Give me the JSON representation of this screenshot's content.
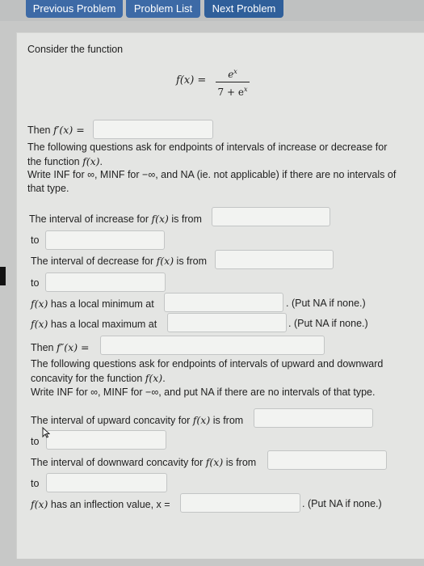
{
  "nav": {
    "previous": "Previous Problem",
    "list": "Problem List",
    "next": "Next Problem"
  },
  "problem": {
    "intro": "Consider the function",
    "formula": {
      "lhs": "f(x) = ",
      "numerator": "e",
      "numerator_exp": "x",
      "denominator_base": "7 + e",
      "denominator_exp": "x"
    },
    "derivative_prompt_prefix": "Then ",
    "derivative_prompt_symbol": "f′(x) =",
    "instructions_1a": "The following questions ask for endpoints of intervals of increase or decrease for the function ",
    "instructions_1b": "f(x)",
    "instructions_1c": ".",
    "instructions_2a": "Write INF for ∞, MINF for −∞, and NA (ie. not applicable) if there are no intervals of that type.",
    "increase_prefix": "The interval of increase for ",
    "increase_fx": "f(x)",
    "increase_suffix": " is from",
    "to_1": "to",
    "decrease_prefix": "The interval of decrease for ",
    "decrease_fx": "f(x)",
    "decrease_suffix": " is from",
    "to_2": "to",
    "min_fx": "f(x)",
    "min_text": " has a local minimum at",
    "min_note": ". (Put NA if none.)",
    "max_fx": "f(x)",
    "max_text": " has a local maximum at",
    "max_note": ". (Put NA if none.)",
    "second_prompt_prefix": "Then ",
    "second_prompt_symbol": "f″(x) =",
    "concavity_instr_a": "The following questions ask for endpoints of intervals of upward and downward concavity for the function ",
    "concavity_instr_b": "f(x)",
    "concavity_instr_c": ".",
    "concavity_instr_2": "Write INF for ∞, MINF for −∞, and put NA if there are no intervals of that type.",
    "up_prefix": "The interval of upward concavity for ",
    "up_fx": "f(x)",
    "up_suffix": " is from",
    "to_3": "to",
    "down_prefix": "The interval of downward concavity for ",
    "down_fx": "f(x)",
    "down_suffix": " is from",
    "to_4": "to",
    "inflection_fx": "f(x)",
    "inflection_text": " has an inflection value, x =",
    "inflection_note": ". (Put NA if none.)"
  },
  "fields": {
    "derivative": "",
    "increase_from": "",
    "increase_to": "",
    "decrease_from": "",
    "decrease_to": "",
    "local_min": "",
    "local_max": "",
    "second_derivative": "",
    "up_from": "",
    "up_to": "",
    "down_from": "",
    "down_to": "",
    "inflection": ""
  }
}
